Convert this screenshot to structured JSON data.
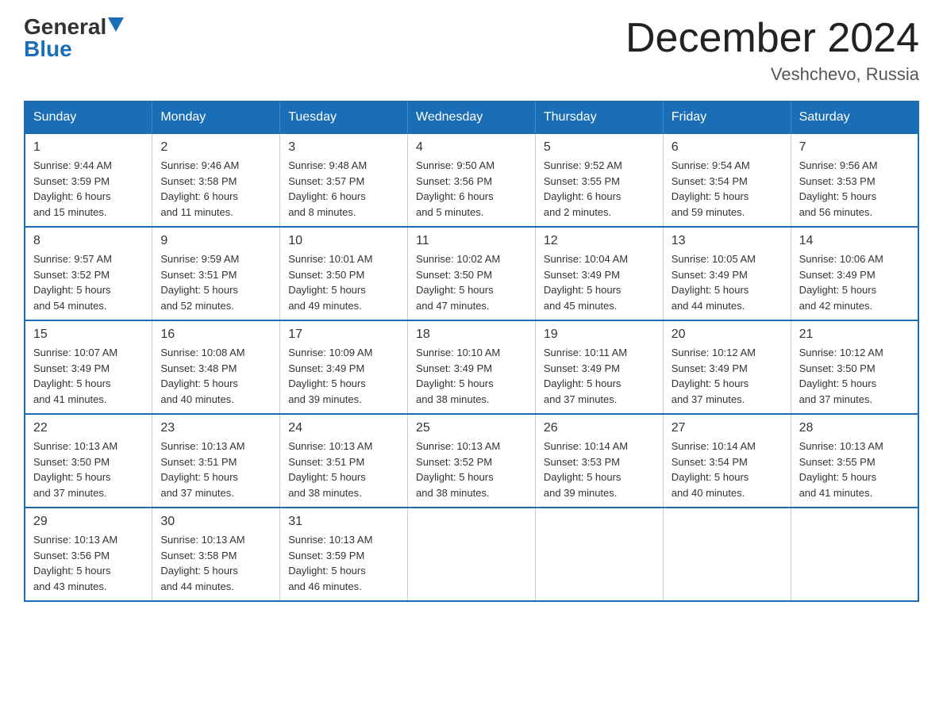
{
  "logo": {
    "general": "General",
    "blue": "Blue",
    "arrowColor": "#1a6eb5"
  },
  "title": "December 2024",
  "location": "Veshchevo, Russia",
  "weekdays": [
    "Sunday",
    "Monday",
    "Tuesday",
    "Wednesday",
    "Thursday",
    "Friday",
    "Saturday"
  ],
  "weeks": [
    [
      {
        "day": "1",
        "sunrise": "9:44 AM",
        "sunset": "3:59 PM",
        "daylight": "6 hours and 15 minutes."
      },
      {
        "day": "2",
        "sunrise": "9:46 AM",
        "sunset": "3:58 PM",
        "daylight": "6 hours and 11 minutes."
      },
      {
        "day": "3",
        "sunrise": "9:48 AM",
        "sunset": "3:57 PM",
        "daylight": "6 hours and 8 minutes."
      },
      {
        "day": "4",
        "sunrise": "9:50 AM",
        "sunset": "3:56 PM",
        "daylight": "6 hours and 5 minutes."
      },
      {
        "day": "5",
        "sunrise": "9:52 AM",
        "sunset": "3:55 PM",
        "daylight": "6 hours and 2 minutes."
      },
      {
        "day": "6",
        "sunrise": "9:54 AM",
        "sunset": "3:54 PM",
        "daylight": "5 hours and 59 minutes."
      },
      {
        "day": "7",
        "sunrise": "9:56 AM",
        "sunset": "3:53 PM",
        "daylight": "5 hours and 56 minutes."
      }
    ],
    [
      {
        "day": "8",
        "sunrise": "9:57 AM",
        "sunset": "3:52 PM",
        "daylight": "5 hours and 54 minutes."
      },
      {
        "day": "9",
        "sunrise": "9:59 AM",
        "sunset": "3:51 PM",
        "daylight": "5 hours and 52 minutes."
      },
      {
        "day": "10",
        "sunrise": "10:01 AM",
        "sunset": "3:50 PM",
        "daylight": "5 hours and 49 minutes."
      },
      {
        "day": "11",
        "sunrise": "10:02 AM",
        "sunset": "3:50 PM",
        "daylight": "5 hours and 47 minutes."
      },
      {
        "day": "12",
        "sunrise": "10:04 AM",
        "sunset": "3:49 PM",
        "daylight": "5 hours and 45 minutes."
      },
      {
        "day": "13",
        "sunrise": "10:05 AM",
        "sunset": "3:49 PM",
        "daylight": "5 hours and 44 minutes."
      },
      {
        "day": "14",
        "sunrise": "10:06 AM",
        "sunset": "3:49 PM",
        "daylight": "5 hours and 42 minutes."
      }
    ],
    [
      {
        "day": "15",
        "sunrise": "10:07 AM",
        "sunset": "3:49 PM",
        "daylight": "5 hours and 41 minutes."
      },
      {
        "day": "16",
        "sunrise": "10:08 AM",
        "sunset": "3:48 PM",
        "daylight": "5 hours and 40 minutes."
      },
      {
        "day": "17",
        "sunrise": "10:09 AM",
        "sunset": "3:49 PM",
        "daylight": "5 hours and 39 minutes."
      },
      {
        "day": "18",
        "sunrise": "10:10 AM",
        "sunset": "3:49 PM",
        "daylight": "5 hours and 38 minutes."
      },
      {
        "day": "19",
        "sunrise": "10:11 AM",
        "sunset": "3:49 PM",
        "daylight": "5 hours and 37 minutes."
      },
      {
        "day": "20",
        "sunrise": "10:12 AM",
        "sunset": "3:49 PM",
        "daylight": "5 hours and 37 minutes."
      },
      {
        "day": "21",
        "sunrise": "10:12 AM",
        "sunset": "3:50 PM",
        "daylight": "5 hours and 37 minutes."
      }
    ],
    [
      {
        "day": "22",
        "sunrise": "10:13 AM",
        "sunset": "3:50 PM",
        "daylight": "5 hours and 37 minutes."
      },
      {
        "day": "23",
        "sunrise": "10:13 AM",
        "sunset": "3:51 PM",
        "daylight": "5 hours and 37 minutes."
      },
      {
        "day": "24",
        "sunrise": "10:13 AM",
        "sunset": "3:51 PM",
        "daylight": "5 hours and 38 minutes."
      },
      {
        "day": "25",
        "sunrise": "10:13 AM",
        "sunset": "3:52 PM",
        "daylight": "5 hours and 38 minutes."
      },
      {
        "day": "26",
        "sunrise": "10:14 AM",
        "sunset": "3:53 PM",
        "daylight": "5 hours and 39 minutes."
      },
      {
        "day": "27",
        "sunrise": "10:14 AM",
        "sunset": "3:54 PM",
        "daylight": "5 hours and 40 minutes."
      },
      {
        "day": "28",
        "sunrise": "10:13 AM",
        "sunset": "3:55 PM",
        "daylight": "5 hours and 41 minutes."
      }
    ],
    [
      {
        "day": "29",
        "sunrise": "10:13 AM",
        "sunset": "3:56 PM",
        "daylight": "5 hours and 43 minutes."
      },
      {
        "day": "30",
        "sunrise": "10:13 AM",
        "sunset": "3:58 PM",
        "daylight": "5 hours and 44 minutes."
      },
      {
        "day": "31",
        "sunrise": "10:13 AM",
        "sunset": "3:59 PM",
        "daylight": "5 hours and 46 minutes."
      },
      null,
      null,
      null,
      null
    ]
  ],
  "labels": {
    "sunrise": "Sunrise:",
    "sunset": "Sunset:",
    "daylight": "Daylight:"
  }
}
